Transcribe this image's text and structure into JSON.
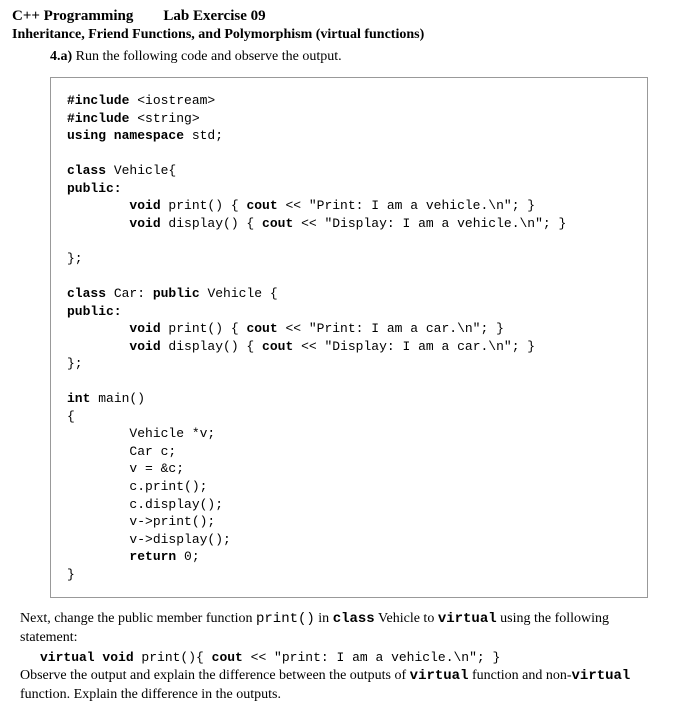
{
  "header": {
    "course": "C++ Programming",
    "exercise": "Lab Exercise 09",
    "topic": "Inheritance, Friend Functions, and Polymorphism (virtual functions)"
  },
  "question": {
    "number": "4.a)",
    "text": "Run the following code and observe the output."
  },
  "code": {
    "line01a": "#include ",
    "line01b": "<iostream>",
    "line02a": "#include ",
    "line02b": "<string>",
    "line03a": "using namespace ",
    "line03b": "std;",
    "line05a": "class ",
    "line05b": "Vehicle{",
    "line06": "public:",
    "line07a": "        void ",
    "line07b": "print() { ",
    "line07c": "cout ",
    "line07d": "<< \"Print: I am a vehicle.\\n\"; }",
    "line08a": "        void ",
    "line08b": "display() { ",
    "line08c": "cout ",
    "line08d": "<< \"Display: I am a vehicle.\\n\"; }",
    "line10": "};",
    "line12a": "class ",
    "line12b": "Car: ",
    "line12c": "public ",
    "line12d": "Vehicle {",
    "line13": "public:",
    "line14a": "        void ",
    "line14b": "print() { ",
    "line14c": "cout ",
    "line14d": "<< \"Print: I am a car.\\n\"; }",
    "line15a": "        void ",
    "line15b": "display() { ",
    "line15c": "cout ",
    "line15d": "<< \"Display: I am a car.\\n\"; }",
    "line16": "};",
    "line18a": "int ",
    "line18b": "main()",
    "line19": "{",
    "line20": "        Vehicle *v;",
    "line21": "        Car c;",
    "line22": "        v = &c;",
    "line23": "        c.print();",
    "line24": "        c.display();",
    "line25": "        v->print();",
    "line26": "        v->display();",
    "line27a": "        return ",
    "line27b": "0;",
    "line28": "}"
  },
  "followup": {
    "p1a": "Next, change the public member function ",
    "p1b": "print()",
    "p1c": " in ",
    "p1d": "class",
    "p1e": " Vehicle to ",
    "p1f": "virtual",
    "p1g": " using the following statement:",
    "stmt_a": "virtual void ",
    "stmt_b": "print(){ ",
    "stmt_c": "cout ",
    "stmt_d": "<< \"print: I am a vehicle.\\n\"; }",
    "p2a": "Observe the output and explain the difference between the outputs of ",
    "p2b": "virtual",
    "p2c": " function and non-",
    "p2d": "virtual",
    "p2e": " function. Explain the difference in the outputs."
  }
}
